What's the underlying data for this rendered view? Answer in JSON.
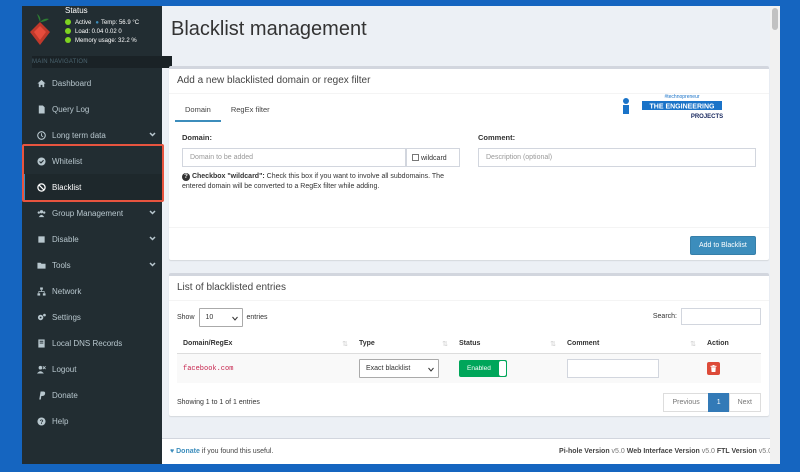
{
  "sidebar": {
    "status": {
      "title": "Status",
      "active": "Active",
      "temp": "Temp: 56.9 °C",
      "load": "Load: 0.04 0.02 0",
      "memory": "Memory usage: 32.2 %"
    },
    "section_label": "MAIN NAVIGATION",
    "items": [
      {
        "label": "Dashboard",
        "icon": "home-icon"
      },
      {
        "label": "Query Log",
        "icon": "file-icon"
      },
      {
        "label": "Long term data",
        "icon": "history-icon",
        "expandable": true
      },
      {
        "label": "Whitelist",
        "icon": "check-circle-icon"
      },
      {
        "label": "Blacklist",
        "icon": "ban-icon",
        "active": true
      },
      {
        "label": "Group Management",
        "icon": "users-icon",
        "expandable": true
      },
      {
        "label": "Disable",
        "icon": "stop-icon",
        "expandable": true
      },
      {
        "label": "Tools",
        "icon": "folder-icon",
        "expandable": true
      },
      {
        "label": "Network",
        "icon": "network-icon"
      },
      {
        "label": "Settings",
        "icon": "gears-icon"
      },
      {
        "label": "Local DNS Records",
        "icon": "dns-icon"
      },
      {
        "label": "Logout",
        "icon": "user-times-icon"
      },
      {
        "label": "Donate",
        "icon": "paypal-icon"
      },
      {
        "label": "Help",
        "icon": "question-circle-icon"
      }
    ]
  },
  "page": {
    "title": "Blacklist management"
  },
  "add_box": {
    "header": "Add a new blacklisted domain or regex filter",
    "tabs": [
      "Domain",
      "RegEx filter"
    ],
    "domain_label": "Domain:",
    "domain_placeholder": "Domain to be added",
    "wildcard_label": "wildcard",
    "comment_label": "Comment:",
    "comment_placeholder": "Description (optional)",
    "help_bold": "Checkbox \"wildcard\":",
    "help_text": " Check this box if you want to involve all subdomains. The entered domain will be converted to a RegEx filter while adding.",
    "add_button": "Add to Blacklist"
  },
  "watermark": {
    "tag": "#technopreneur",
    "line1": "THE ENGINEERING",
    "line2": "PROJECTS"
  },
  "list_box": {
    "header": "List of blacklisted entries",
    "show_label": "Show",
    "entries_value": "10",
    "entries_label": "entries",
    "search_label": "Search:",
    "columns": [
      "Domain/RegEx",
      "Type",
      "Status",
      "Comment",
      "Action"
    ],
    "rows": [
      {
        "domain": "facebook.com",
        "type": "Exact blacklist",
        "status": "Enabled",
        "comment": ""
      }
    ],
    "info": "Showing 1 to 1 of 1 entries",
    "pager": {
      "previous": "Previous",
      "page": "1",
      "next": "Next"
    }
  },
  "footer": {
    "donate_link": "Donate",
    "donate_text": " if you found this useful.",
    "pihole_label": "Pi-hole Version",
    "pihole_version": " v5.0 ",
    "web_label": "Web Interface Version",
    "web_version": " v5.0 ",
    "ftl_label": "FTL Version",
    "ftl_version": " v5.0"
  },
  "colors": {
    "accent": "#3c8dbc",
    "sidebar_bg": "#222d32",
    "highlight": "#e8543f",
    "enabled": "#00a65a",
    "danger": "#dd4b39"
  }
}
